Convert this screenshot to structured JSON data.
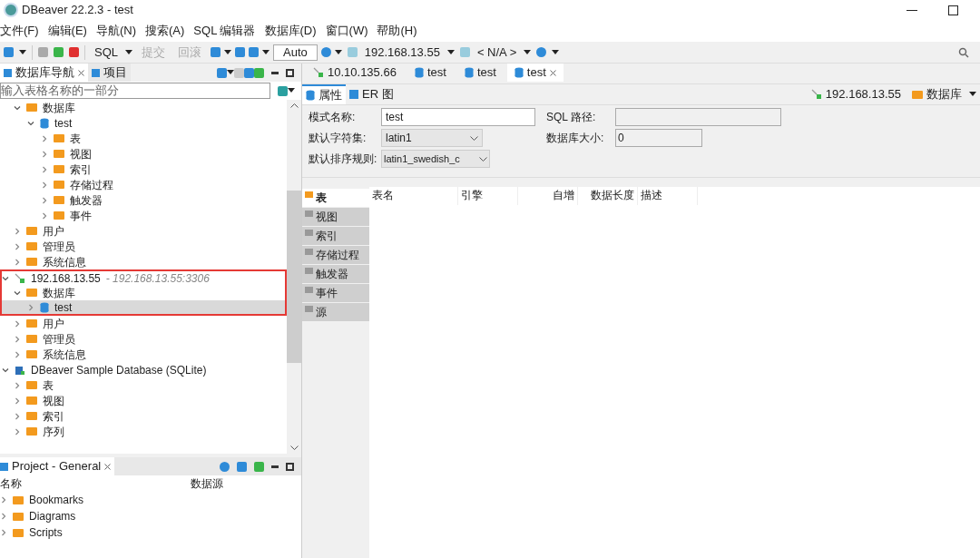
{
  "window": {
    "title": "DBeaver 22.2.3 - test"
  },
  "menu": [
    "文件(F)",
    "编辑(E)",
    "导航(N)",
    "搜索(A)",
    "SQL 编辑器",
    "数据库(D)",
    "窗口(W)",
    "帮助(H)"
  ],
  "toolbar": [
    {
      "kind": "button",
      "label": "SQL",
      "disabled": false
    },
    {
      "kind": "button",
      "label": "提交",
      "disabled": true
    },
    {
      "kind": "button",
      "label": "回滚",
      "disabled": true
    },
    {
      "kind": "field",
      "label": "Auto"
    },
    {
      "kind": "combo",
      "label": "192.168.13.55"
    },
    {
      "kind": "combo",
      "label": "< N/A >"
    }
  ],
  "navigator": {
    "tabs": [
      {
        "label": "数据库导航",
        "selected": true
      },
      {
        "label": "项目",
        "selected": false
      }
    ],
    "filter": {
      "placeholder": "输入表格名称的一部分"
    },
    "tree": [
      {
        "label": "数据库",
        "kind": "folder",
        "expanded": true,
        "children": [
          {
            "label": "test",
            "kind": "database",
            "expanded": true,
            "children": [
              {
                "label": "表",
                "kind": "folder",
                "expanded": false
              },
              {
                "label": "视图",
                "kind": "folder",
                "expanded": false
              },
              {
                "label": "索引",
                "kind": "folder",
                "expanded": false
              },
              {
                "label": "存储过程",
                "kind": "folder",
                "expanded": false
              },
              {
                "label": "触发器",
                "kind": "folder",
                "expanded": false
              },
              {
                "label": "事件",
                "kind": "folder",
                "expanded": false
              }
            ]
          }
        ]
      },
      {
        "label": "用户",
        "kind": "folder",
        "expanded": false
      },
      {
        "label": "管理员",
        "kind": "folder",
        "expanded": false
      },
      {
        "label": "系统信息",
        "kind": "folder",
        "expanded": false
      },
      {
        "label": "192.168.13.55",
        "detail": "- 192.168.13.55:3306",
        "kind": "connection",
        "expanded": true,
        "boxed": true,
        "children": [
          {
            "label": "数据库",
            "kind": "folder",
            "expanded": true,
            "boxed": true,
            "children": [
              {
                "label": "test",
                "kind": "database",
                "expanded": false,
                "selected": true,
                "boxed": true
              }
            ]
          },
          {
            "label": "用户",
            "kind": "folder",
            "expanded": false
          },
          {
            "label": "管理员",
            "kind": "folder",
            "expanded": false
          },
          {
            "label": "系统信息",
            "kind": "folder",
            "expanded": false
          }
        ]
      },
      {
        "label": "DBeaver Sample Database (SQLite)",
        "kind": "sqlite",
        "expanded": true,
        "children": [
          {
            "label": "表",
            "kind": "folder",
            "expanded": false
          },
          {
            "label": "视图",
            "kind": "folder",
            "expanded": false
          },
          {
            "label": "索引",
            "kind": "folder",
            "expanded": false
          },
          {
            "label": "序列",
            "kind": "folder",
            "expanded": false
          }
        ]
      }
    ]
  },
  "project": {
    "title": "Project - General",
    "columns": [
      "名称",
      "数据源"
    ],
    "items": [
      "Bookmarks",
      "Diagrams",
      "Scripts"
    ]
  },
  "editor_tabs": [
    {
      "label": "10.10.135.66",
      "kind": "connection",
      "selected": false
    },
    {
      "label": "test",
      "kind": "database",
      "selected": false
    },
    {
      "label": "test",
      "kind": "database",
      "selected": false
    },
    {
      "label": "test",
      "kind": "database",
      "selected": true
    }
  ],
  "subtabs": [
    {
      "label": "属性",
      "selected": true
    },
    {
      "label": "ER 图",
      "selected": false
    }
  ],
  "breadcrumb": {
    "connection": "192.168.13.55",
    "folder": "数据库"
  },
  "form": {
    "schema_name_label": "模式名称:",
    "schema_name": "test",
    "sql_path_label": "SQL 路径:",
    "charset_label": "默认字符集:",
    "charset": "latin1",
    "db_size_label": "数据库大小:",
    "db_size": "0",
    "collation_label": "默认排序规则:",
    "collation": "latin1_swedish_c"
  },
  "side_tabs": [
    {
      "label": "表",
      "selected": true
    },
    {
      "label": "视图",
      "selected": false
    },
    {
      "label": "索引",
      "selected": false
    },
    {
      "label": "存储过程",
      "selected": false
    },
    {
      "label": "触发器",
      "selected": false
    },
    {
      "label": "事件",
      "selected": false
    },
    {
      "label": "源",
      "selected": false
    }
  ],
  "table": {
    "columns": [
      "表名",
      "引擎",
      "自增",
      "数据长度",
      "描述"
    ]
  }
}
